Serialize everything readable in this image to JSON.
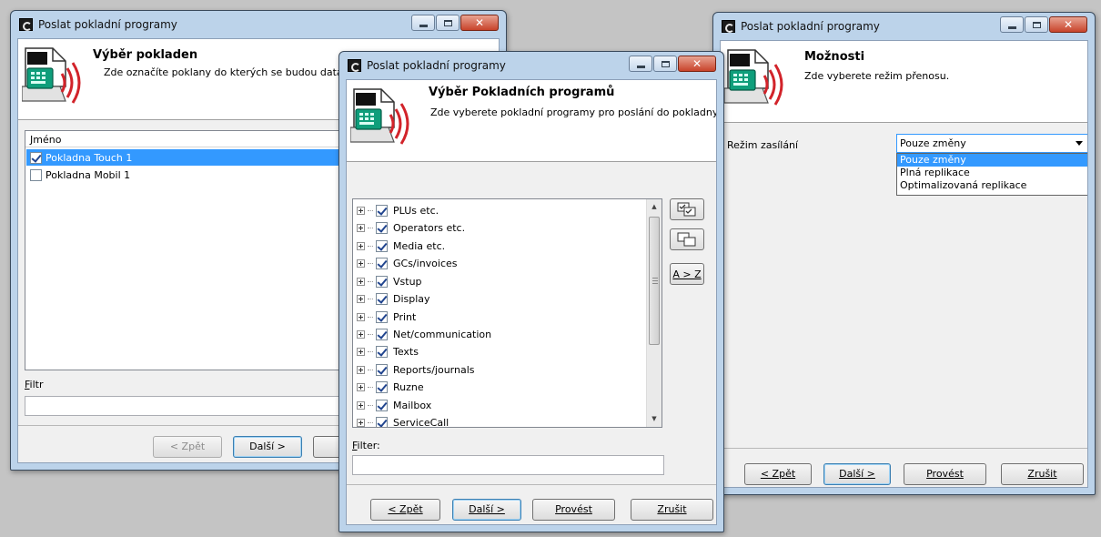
{
  "window_title": "Poslat pokladní programy",
  "wizard1": {
    "heading": "Výběr pokladen",
    "description": "Zde označíte poklany do kterých se budou data po",
    "list_header": "Jméno",
    "items": [
      {
        "label": "Pokladna Touch 1",
        "checked": true,
        "selected": true
      },
      {
        "label": "Pokladna Mobil 1",
        "checked": false,
        "selected": false
      }
    ],
    "filter_label_mnemonic": "F",
    "filter_label_rest": "iltr",
    "filter_value": "",
    "back_button": "< Zpět",
    "next_button": "Další >"
  },
  "wizard2": {
    "heading": "Výběr Pokladních programů",
    "description": "Zde vyberete pokladní programy pro poslání do pokladny.",
    "tree_items": [
      "PLUs etc.",
      "Operators etc.",
      "Media etc.",
      "GCs/invoices",
      "Vstup",
      "Display",
      "Print",
      "Net/communication",
      "Texts",
      "Reports/journals",
      "Ruzne",
      "Mailbox",
      "ServiceCall"
    ],
    "sort_button": "A > Z",
    "filter_label_mnemonic": "F",
    "filter_label_rest": "ilter:",
    "filter_value": "",
    "back_button": "< Zpět",
    "next_button": "Další >",
    "execute_button": "Provést",
    "cancel_button": "Zrušit"
  },
  "wizard3": {
    "heading": "Možnosti",
    "description": "Zde vyberete režim přenosu.",
    "mode_label": "Režim zasílání",
    "mode_value": "Pouze změny",
    "mode_options": [
      "Pouze změny",
      "Plná replikace",
      "Optimalizovaná replikace"
    ],
    "back_button": "< Zpět",
    "next_button": "Další >",
    "execute_button": "Provést",
    "cancel_button": "Zrušit"
  },
  "colors": {
    "selection": "#3399ff",
    "window_frame": "#bcd3ea",
    "close_button": "#c8432a",
    "register_screen_green": "#0f9e7b",
    "signal_red": "#d2232a"
  },
  "icons": [
    "cash-register-icon",
    "check-all-icon",
    "uncheck-all-icon",
    "app-icon"
  ]
}
